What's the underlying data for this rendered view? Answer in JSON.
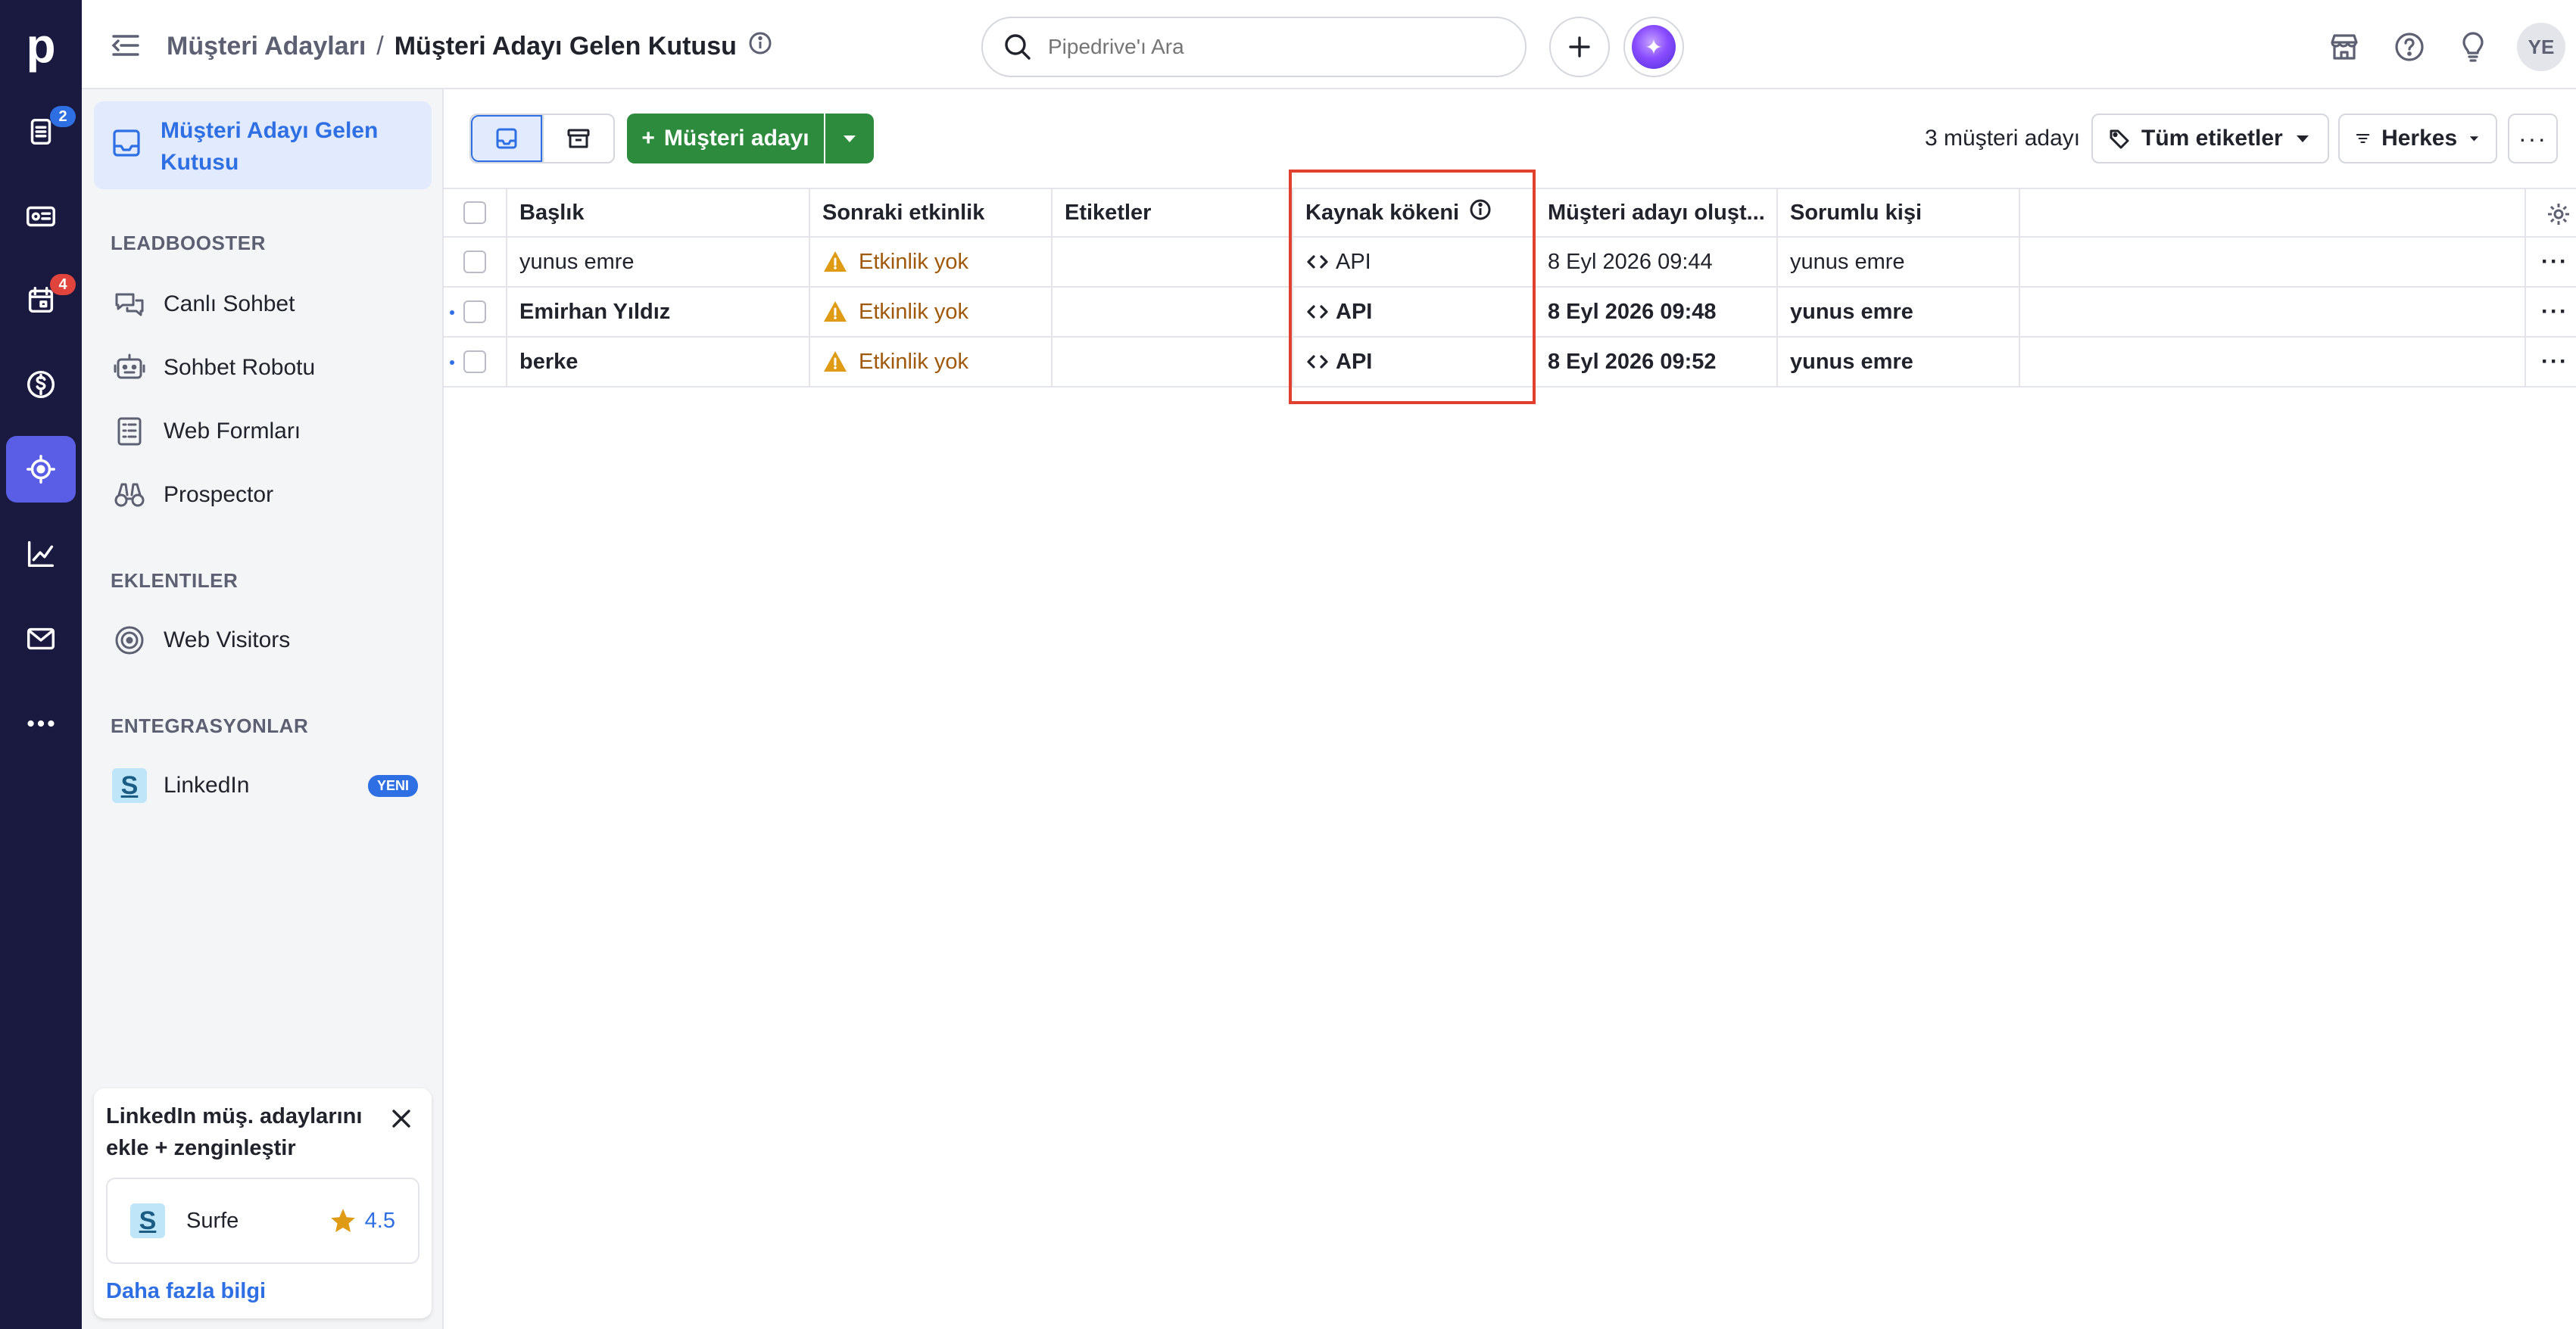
{
  "rail": {
    "logo": "p",
    "items": [
      {
        "icon": "leads-icon",
        "badge": "2",
        "badge_color": "#2f6fe4"
      },
      {
        "icon": "contacts-icon",
        "badge": ""
      },
      {
        "icon": "calendar-icon",
        "badge": "4",
        "badge_color": "#e0443c"
      },
      {
        "icon": "dollar-icon",
        "badge": ""
      },
      {
        "icon": "leadbooster-target-icon",
        "badge": "",
        "active": true
      },
      {
        "icon": "insights-chart-icon",
        "badge": ""
      },
      {
        "icon": "mail-icon",
        "badge": ""
      },
      {
        "icon": "more-dots-icon",
        "badge": ""
      }
    ]
  },
  "header": {
    "breadcrumb_parent": "Müşteri Adayları",
    "breadcrumb_sep": "/",
    "breadcrumb_current": "Müşteri Adayı Gelen Kutusu",
    "search_placeholder": "Pipedrive'ı Ara",
    "avatar_initials": "YE"
  },
  "sidebar": {
    "active_item": "Müşteri Adayı Gelen Kutusu",
    "sections": [
      {
        "title": "LEADBOOSTER",
        "items": [
          "Canlı Sohbet",
          "Sohbet Robotu",
          "Web Formları",
          "Prospector"
        ]
      },
      {
        "title": "EKLENTILER",
        "items": [
          "Web Visitors"
        ]
      },
      {
        "title": "ENTEGRASYONLAR",
        "items": [
          "LinkedIn"
        ]
      }
    ],
    "linkedin_badge": "YENI",
    "promo": {
      "title": "LinkedIn müş. adaylarını ekle + zenginleştir",
      "app_logo": "S",
      "app_name": "Surfe",
      "rating": "4.5",
      "link": "Daha fazla bilgi"
    }
  },
  "toolbar": {
    "add_label": "Müşteri adayı",
    "add_plus": "+",
    "count": "3 müşteri adayı",
    "labels_filter": "Tüm etiketler",
    "owner_filter": "Herkes",
    "more": "···"
  },
  "table": {
    "columns": [
      "Başlık",
      "Sonraki etkinlik",
      "Etiketler",
      "Kaynak kökeni",
      "Müşteri adayı oluşt...",
      "Sorumlu kişi"
    ],
    "rows": [
      {
        "title": "yunus emre",
        "next_activity": "Etkinlik yok",
        "labels": "",
        "source": "API",
        "created": "8 Eyl 2026 09:44",
        "owner": "yunus emre",
        "unread": false
      },
      {
        "title": "Emirhan Yıldız",
        "next_activity": "Etkinlik yok",
        "labels": "",
        "source": "API",
        "created": "8 Eyl 2026 09:48",
        "owner": "yunus emre",
        "unread": true
      },
      {
        "title": "berke",
        "next_activity": "Etkinlik yok",
        "labels": "",
        "source": "API",
        "created": "8 Eyl 2026 09:52",
        "owner": "yunus emre",
        "unread": true
      }
    ],
    "row_more": "···"
  },
  "colors": {
    "rail_bg": "#1a1a40",
    "accent_blue": "#2f6fe4",
    "add_button_green": "#2c8b3c",
    "warning": "#a0590a",
    "highlight_box": "#e2402f"
  }
}
